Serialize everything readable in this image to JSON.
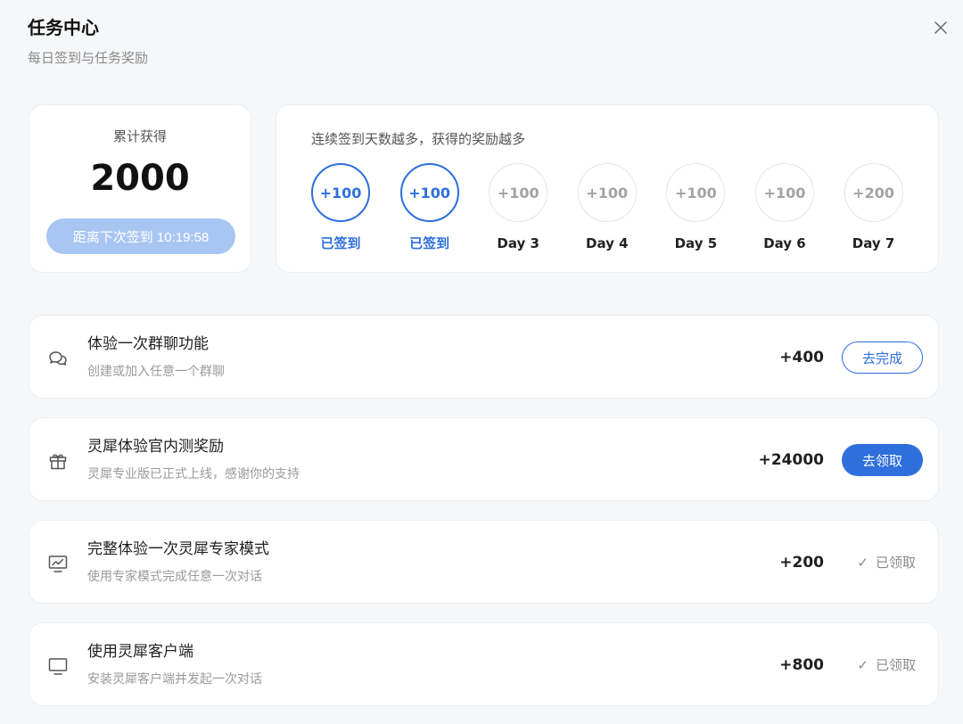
{
  "header": {
    "title": "任务中心",
    "subtitle": "每日签到与任务奖励"
  },
  "total": {
    "label": "累计获得",
    "value": "2000",
    "countdown_label": "距离下次签到 10:19:58"
  },
  "streak": {
    "tip": "连续签到天数越多，获得的奖励越多",
    "days": [
      {
        "reward": "+100",
        "label": "已签到",
        "status": "done"
      },
      {
        "reward": "+100",
        "label": "已签到",
        "status": "done"
      },
      {
        "reward": "+100",
        "label": "Day 3",
        "status": "pending"
      },
      {
        "reward": "+100",
        "label": "Day 4",
        "status": "pending"
      },
      {
        "reward": "+100",
        "label": "Day 5",
        "status": "pending"
      },
      {
        "reward": "+100",
        "label": "Day 6",
        "status": "pending"
      },
      {
        "reward": "+200",
        "label": "Day 7",
        "status": "pending"
      }
    ]
  },
  "tasks": [
    {
      "icon": "chat-icon",
      "title": "体验一次群聊功能",
      "desc": "创建或加入任意一个群聊",
      "reward": "+400",
      "action": "去完成",
      "state": "todo"
    },
    {
      "icon": "gift-icon",
      "title": "灵犀体验官内测奖励",
      "desc": "灵犀专业版已正式上线，感谢你的支持",
      "reward": "+24000",
      "action": "去领取",
      "state": "claimable"
    },
    {
      "icon": "chart-monitor-icon",
      "title": "完整体验一次灵犀专家模式",
      "desc": "使用专家模式完成任意一次对话",
      "reward": "+200",
      "action": "已领取",
      "state": "claimed"
    },
    {
      "icon": "monitor-icon",
      "title": "使用灵犀客户端",
      "desc": "安装灵犀客户端并发起一次对话",
      "reward": "+800",
      "action": "已领取",
      "state": "claimed"
    }
  ],
  "colors": {
    "accent": "#2e6fdc",
    "accent_light": "#a9c6f3",
    "background": "#f6f7f9"
  }
}
